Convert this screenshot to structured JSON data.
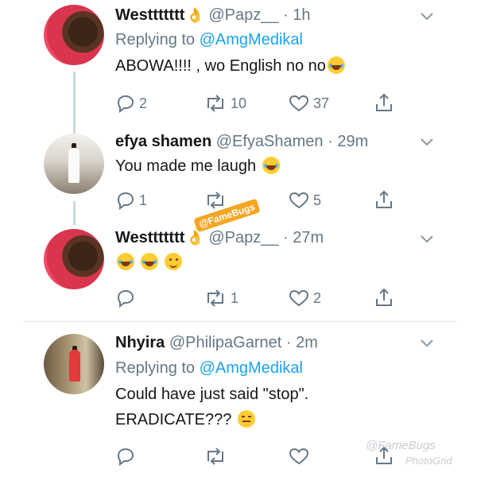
{
  "tweets": [
    {
      "name": "Westtttttt",
      "handle": "@Papz__",
      "time": "· 1h",
      "replying_prefix": "Replying to ",
      "replying_to": "@AmgMedikal",
      "text": "ABOWA!!!! , wo English no no",
      "replies": "2",
      "retweets": "10",
      "likes": "37"
    },
    {
      "name": "efya shamen",
      "handle": "@EfyaShamen",
      "time": "· 29m",
      "text": "You made me laugh",
      "replies": "1",
      "retweets": "",
      "likes": "5"
    },
    {
      "name": "Westtttttt",
      "handle": "@Papz__",
      "time": "· 27m",
      "text": "",
      "replies": "",
      "retweets": "1",
      "likes": "2"
    },
    {
      "name": "Nhyira",
      "handle": "@PhilipaGarnet",
      "time": "· 2m",
      "replying_prefix": "Replying to ",
      "replying_to": "@AmgMedikal",
      "text_line1": "Could have just said \"stop\".",
      "text_line2": "ERADICATE???",
      "replies": "",
      "retweets": "",
      "likes": ""
    }
  ],
  "watermarks": {
    "sticker": "@FameBugs",
    "bottom1": "@FameBugs",
    "bottom2": "PhotoGrid"
  },
  "colors": {
    "name": "#14171a",
    "secondary": "#657786",
    "link": "#1da1f2",
    "divider": "#e1e8ed"
  }
}
